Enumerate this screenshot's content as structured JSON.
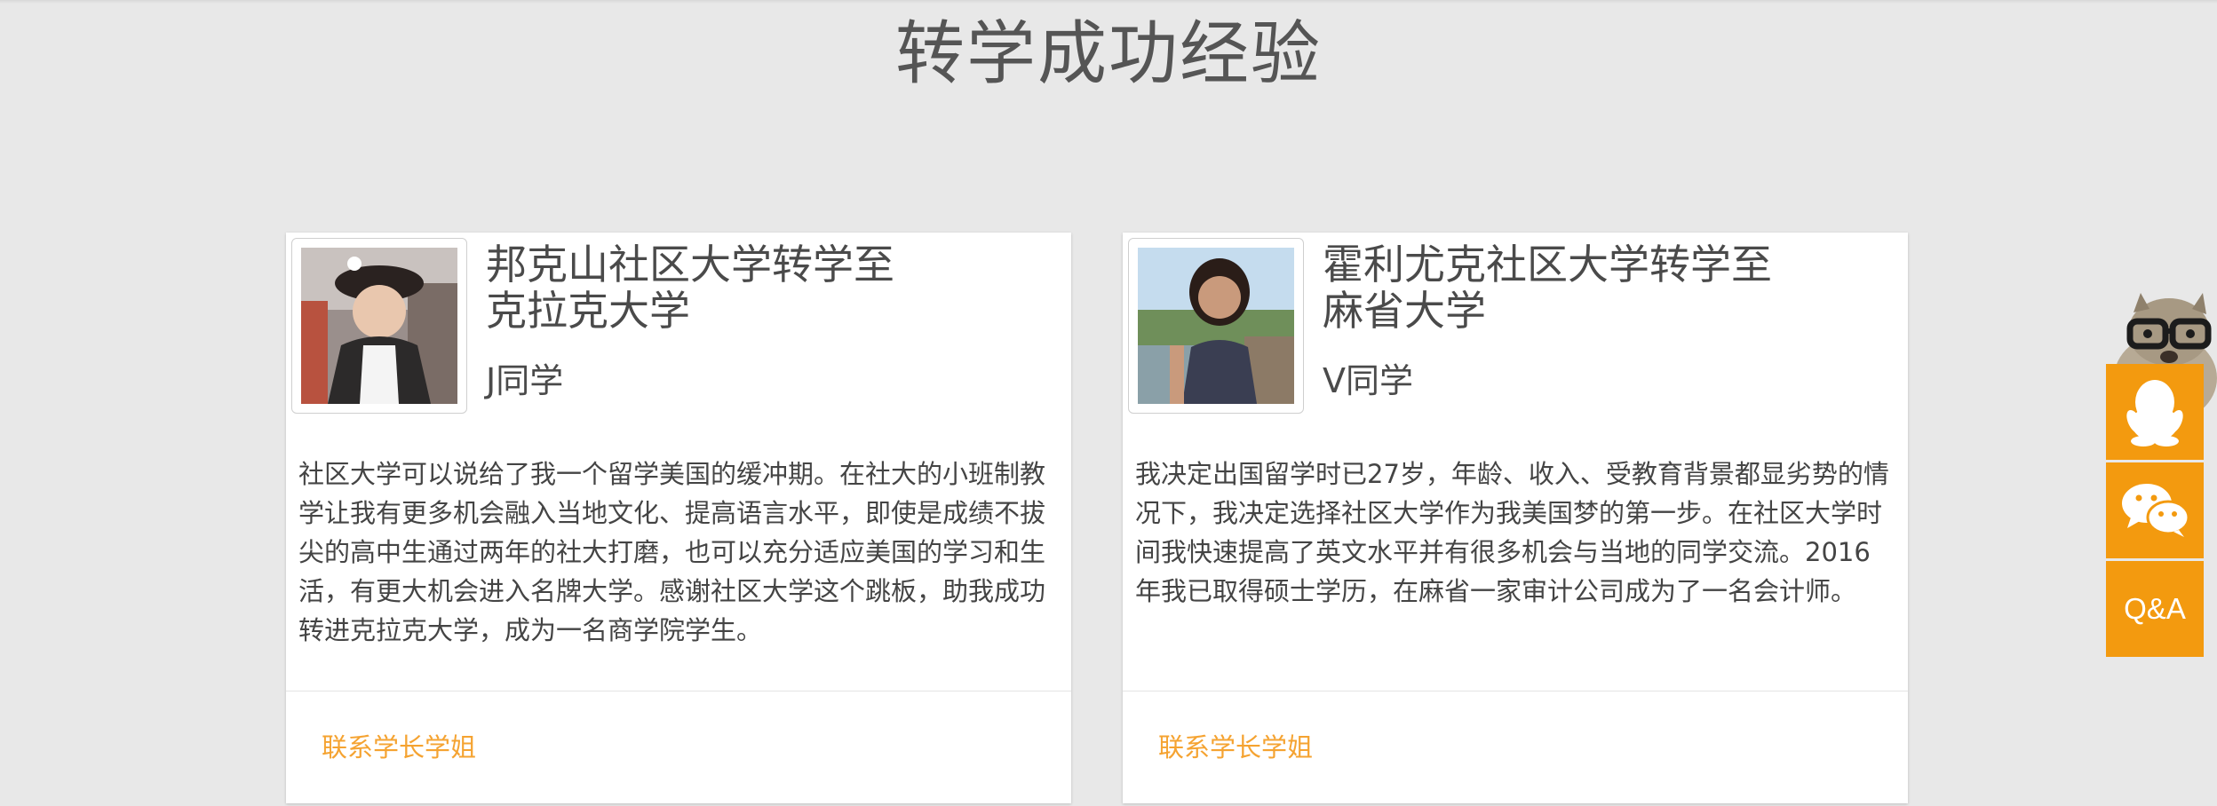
{
  "section": {
    "title": "转学成功经验"
  },
  "cards": [
    {
      "school_line1": "邦克山社区大学转学至",
      "school_line2": "克拉克大学",
      "student": "J同学",
      "story": "社区大学可以说给了我一个留学美国的缓冲期。在社大的小班制教学让我有更多机会融入当地文化、提高语言水平，即使是成绩不拔尖的高中生通过两年的社大打磨，也可以充分适应美国的学习和生活，有更大机会进入名牌大学。感谢社区大学这个跳板，助我成功转进克拉克大学，成为一名商学院学生。",
      "contact_label": "联系学长学姐"
    },
    {
      "school_line1": "霍利尤克社区大学转学至",
      "school_line2": "麻省大学",
      "student": "V同学",
      "story": "我决定出国留学时已27岁，年龄、收入、受教育背景都显劣势的情况下，我决定选择社区大学作为我美国梦的第一步。在社区大学时间我快速提高了英文水平并有很多机会与当地的同学交流。2016年我已取得硕士学历，在麻省一家审计公司成为了一名会计师。",
      "contact_label": "联系学长学姐"
    }
  ],
  "sidebar": {
    "qa_label": "Q&A",
    "icons": [
      "squirrel-mascot",
      "qq-penguin-icon",
      "wechat-icon"
    ]
  },
  "colors": {
    "accent": "#f39a0f",
    "link": "#f5a331",
    "background": "#e8e8e8"
  }
}
